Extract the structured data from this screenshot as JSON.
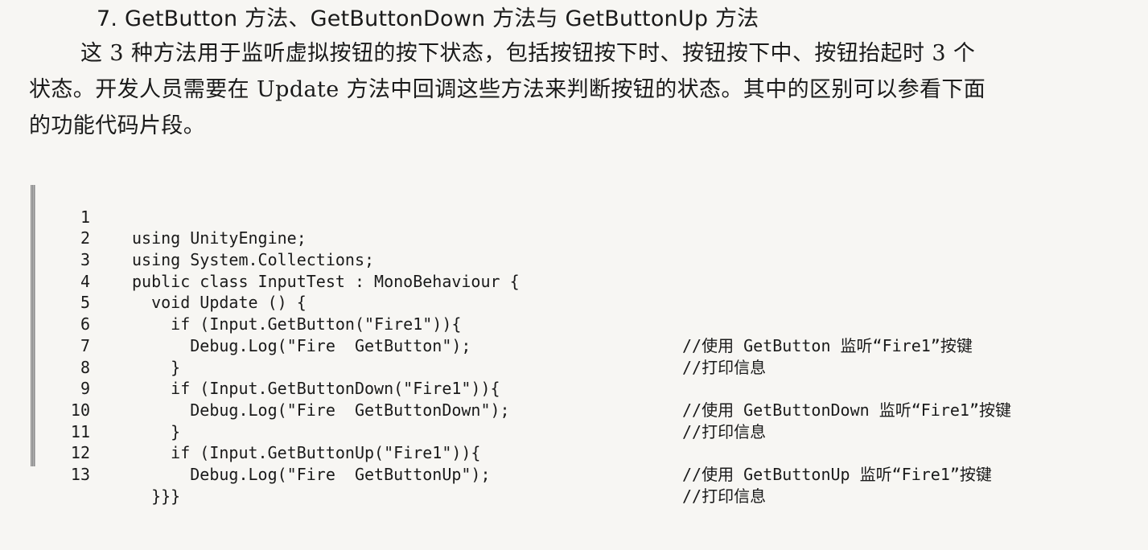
{
  "section": {
    "heading": "7. GetButton 方法、GetButtonDown 方法与 GetButtonUp 方法"
  },
  "paragraph": {
    "line1": "这 3 种方法用于监听虚拟按钮的按下状态，包括按钮按下时、按钮按下中、按钮抬起时 3 个",
    "line2": "状态。开发人员需要在 Update 方法中回调这些方法来判断按钮的状态。其中的区别可以参看下面",
    "line3": "的功能代码片段。"
  },
  "code": {
    "lines": [
      {
        "num": "1",
        "text": "using UnityEngine;",
        "comment": ""
      },
      {
        "num": "2",
        "text": "using System.Collections;",
        "comment": ""
      },
      {
        "num": "3",
        "text": "public class InputTest : MonoBehaviour {",
        "comment": ""
      },
      {
        "num": "4",
        "text": "  void Update () {",
        "comment": ""
      },
      {
        "num": "5",
        "text": "    if (Input.GetButton(\"Fire1\")){",
        "comment": "//使用 GetButton 监听“Fire1”按键"
      },
      {
        "num": "6",
        "text": "      Debug.Log(\"Fire  GetButton\");",
        "comment": "//打印信息"
      },
      {
        "num": "7",
        "text": "    }",
        "comment": ""
      },
      {
        "num": "8",
        "text": "    if (Input.GetButtonDown(\"Fire1\")){",
        "comment": "//使用 GetButtonDown 监听“Fire1”按键"
      },
      {
        "num": "9",
        "text": "      Debug.Log(\"Fire  GetButtonDown\");",
        "comment": "//打印信息"
      },
      {
        "num": "10",
        "text": "    }",
        "comment": ""
      },
      {
        "num": "11",
        "text": "    if (Input.GetButtonUp(\"Fire1\")){",
        "comment": "//使用 GetButtonUp 监听“Fire1”按键"
      },
      {
        "num": "12",
        "text": "      Debug.Log(\"Fire  GetButtonUp\");",
        "comment": "//打印信息"
      },
      {
        "num": "13",
        "text": "  }}}",
        "comment": ""
      }
    ]
  }
}
